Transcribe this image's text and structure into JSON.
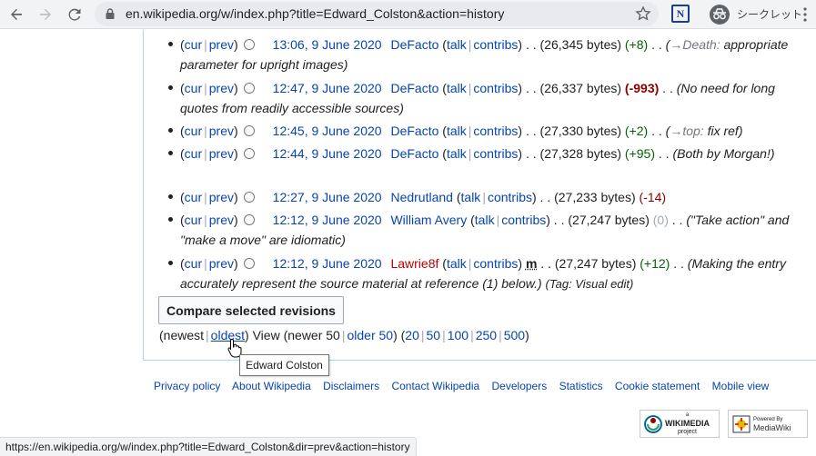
{
  "browser": {
    "url": "en.wikipedia.org/w/index.php?title=Edward_Colston&action=history",
    "incognito_label": "シークレット",
    "extension_letter": "N"
  },
  "revisions": [
    {
      "cur": "cur",
      "prev": "prev",
      "time": "13:06, 9 June 2020",
      "user": "DeFacto",
      "user_red": false,
      "talk": "talk",
      "contribs": "contribs",
      "minor": "",
      "size": "(26,345 bytes)",
      "diff": "(+8)",
      "diff_kind": "pos",
      "comment_arrow": "→Death:",
      "comment": " appropriate parameter for upright images)",
      "comment_line1": "(",
      "tag": ""
    },
    {
      "cur": "cur",
      "prev": "prev",
      "time": "12:47, 9 June 2020",
      "user": "DeFacto",
      "user_red": false,
      "talk": "talk",
      "contribs": "contribs",
      "minor": "",
      "size": "(26,337 bytes)",
      "diff": "(-993)",
      "diff_kind": "neg",
      "comment_arrow": "",
      "comment": "(No need for long quotes from readily accessible sources)",
      "comment_line1": "",
      "tag": ""
    },
    {
      "cur": "cur",
      "prev": "prev",
      "time": "12:45, 9 June 2020",
      "user": "DeFacto",
      "user_red": false,
      "talk": "talk",
      "contribs": "contribs",
      "minor": "",
      "size": "(27,330 bytes)",
      "diff": "(+2)",
      "diff_kind": "pos",
      "comment_arrow": "→top:",
      "comment": " fix ref)",
      "comment_line1": "(",
      "tag": ""
    },
    {
      "cur": "cur",
      "prev": "prev",
      "time": "12:44, 9 June 2020",
      "user": "DeFacto",
      "user_red": false,
      "talk": "talk",
      "contribs": "contribs",
      "minor": "",
      "size": "(27,328 bytes)",
      "diff": "(+95)",
      "diff_kind": "pos",
      "comment_arrow": "",
      "comment": "(Both by Morgan!)",
      "comment_line1": "",
      "tag": ""
    },
    {
      "cur": "cur",
      "prev": "prev",
      "time": "12:27, 9 June 2020",
      "user": "Nedrutland",
      "user_red": false,
      "talk": "talk",
      "contribs": "contribs",
      "minor": "",
      "size": "(27,233 bytes)",
      "diff": "(-14)",
      "diff_kind": "negsmall",
      "comment_arrow": "",
      "comment": "",
      "comment_line1": "",
      "tag": ""
    },
    {
      "cur": "cur",
      "prev": "prev",
      "time": "12:12, 9 June 2020",
      "user": "William Avery",
      "user_red": false,
      "talk": "talk",
      "contribs": "contribs",
      "minor": "",
      "size": "(27,247 bytes)",
      "diff": "(0)",
      "diff_kind": "zero",
      "comment_arrow": "",
      "comment": "(\"Take action\" and \"make a move\" are idiomatic)",
      "comment_line1": "",
      "tag": ""
    },
    {
      "cur": "cur",
      "prev": "prev",
      "time": "12:12, 9 June 2020",
      "user": "Lawrie8f",
      "user_red": true,
      "talk": "talk",
      "contribs": "contribs",
      "minor": "m",
      "size": "(27,247 bytes)",
      "diff": "(+12)",
      "diff_kind": "pos",
      "comment_arrow": "",
      "comment": "(Making the entry accurately represent the source material at reference (1) below.)",
      "comment_line1": "",
      "tag": "(Tag: Visual edit)"
    }
  ],
  "compare_button": "Compare selected revisions",
  "pager": {
    "newest": "newest",
    "oldest": "oldest",
    "view": "View",
    "newer": "newer 50",
    "older": "older 50",
    "limits": [
      "20",
      "50",
      "100",
      "250",
      "500"
    ]
  },
  "tooltip": "Edward Colston",
  "footer": [
    "Privacy policy",
    "About Wikipedia",
    "Disclaimers",
    "Contact Wikipedia",
    "Developers",
    "Statistics",
    "Cookie statement",
    "Mobile view"
  ],
  "badges": {
    "wikimedia_small": "a",
    "wikimedia_name": "WIKIMEDIA",
    "wikimedia_sub": "project",
    "mediawiki_small": "Powered By",
    "mediawiki_name": "MediaWiki"
  },
  "status_url": "https://en.wikipedia.org/w/index.php?title=Edward_Colston&dir=prev&action=history",
  "colors": {
    "link": "#0645ad",
    "redlink": "#ba0000",
    "pos": "#006400",
    "neg": "#8b0000",
    "border": "#a7d7f9"
  }
}
